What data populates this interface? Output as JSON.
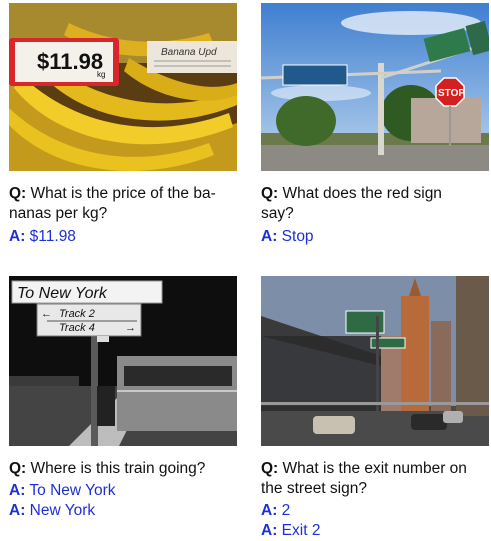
{
  "items": [
    {
      "q_label": "Q:",
      "question_lines": [
        "What is the price of the ba-",
        "nanas per kg?"
      ],
      "answers": [
        {
          "label": "A:",
          "text": "$11.98"
        }
      ],
      "photo_text": {
        "price": "$11.98",
        "unit": "kg",
        "card": "Banana Upd"
      }
    },
    {
      "q_label": "Q:",
      "question_lines": [
        "What does the red sign",
        "say?"
      ],
      "answers": [
        {
          "label": "A:",
          "text": "Stop"
        }
      ],
      "photo_text": {
        "stop": "STOP"
      }
    },
    {
      "q_label": "Q:",
      "question_lines": [
        "Where is this train going?"
      ],
      "answers": [
        {
          "label": "A:",
          "text": "To New York"
        },
        {
          "label": "A:",
          "text": "New York"
        }
      ],
      "photo_text": {
        "sign": "To New York",
        "track1": "Track 2",
        "track2": "Track 4"
      }
    },
    {
      "q_label": "Q:",
      "question_lines": [
        "What is the exit number on",
        "the street sign?"
      ],
      "answers": [
        {
          "label": "A:",
          "text": "2"
        },
        {
          "label": "A:",
          "text": "Exit 2"
        }
      ],
      "photo_text": {}
    }
  ]
}
